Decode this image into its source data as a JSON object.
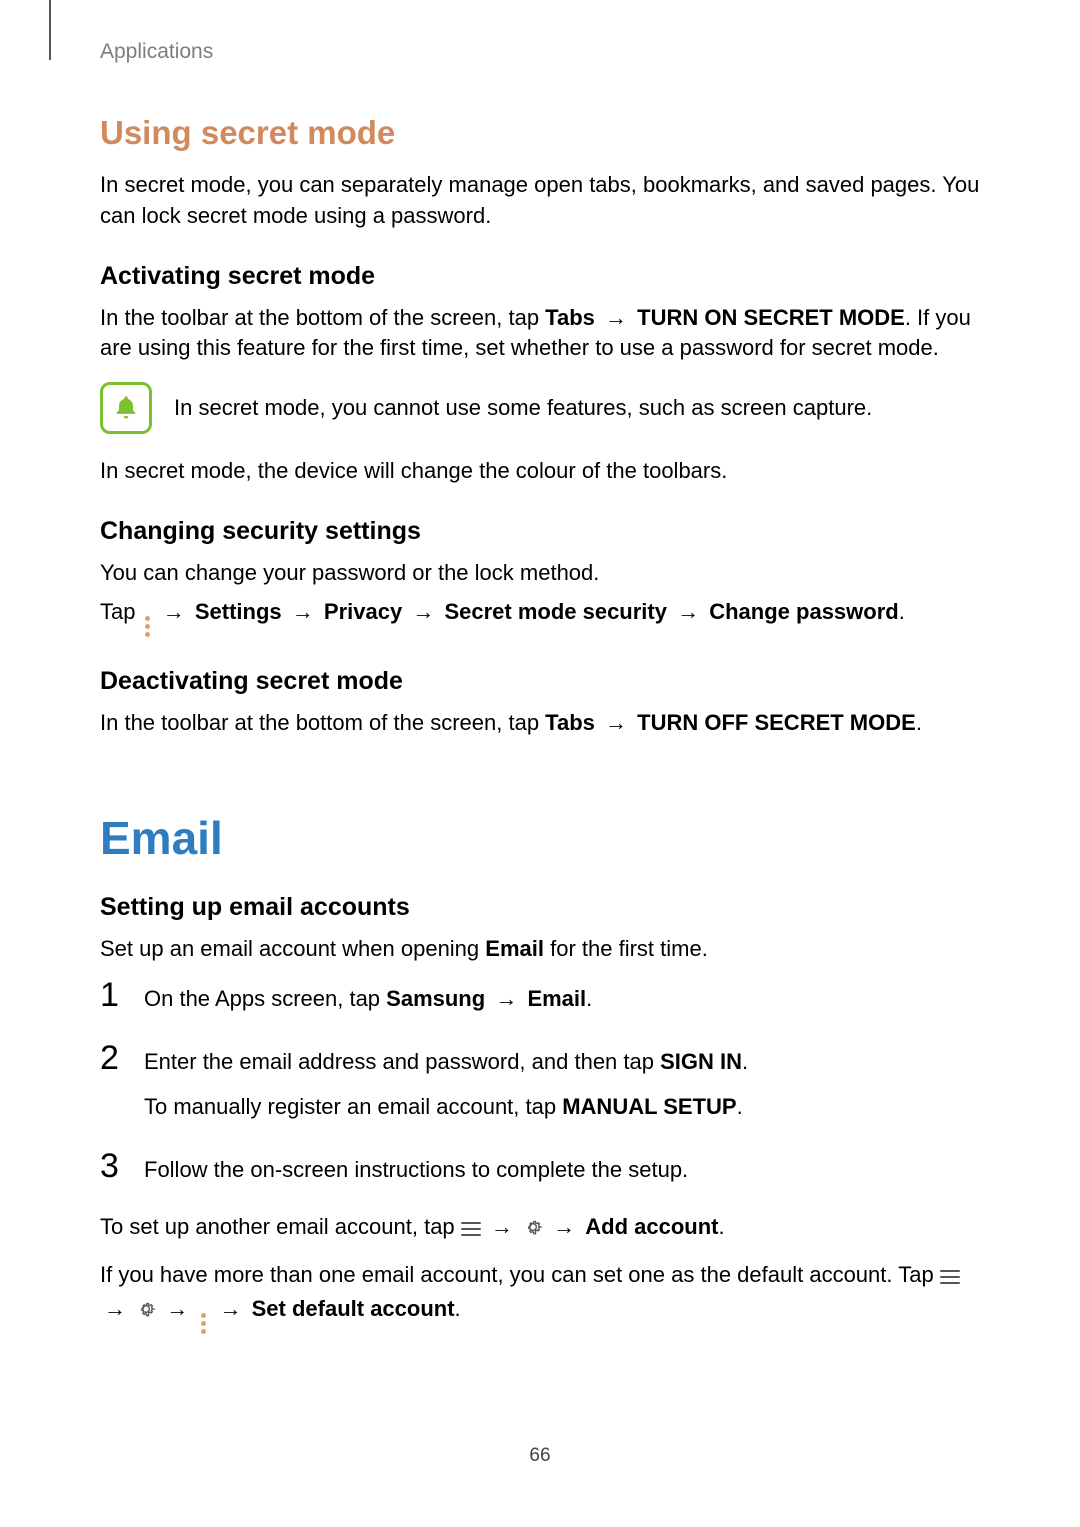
{
  "header": {
    "section": "Applications"
  },
  "secret_mode": {
    "title": "Using secret mode",
    "intro": "In secret mode, you can separately manage open tabs, bookmarks, and saved pages. You can lock secret mode using a password.",
    "activating": {
      "heading": "Activating secret mode",
      "p1_a": "In the toolbar at the bottom of the screen, tap ",
      "tabs": "Tabs",
      "arrow": "→",
      "turn_on": "TURN ON SECRET MODE",
      "p1_b": ". If you are using this feature for the first time, set whether to use a password for secret mode.",
      "note": "In secret mode, you cannot use some features, such as screen capture.",
      "after_note": "In secret mode, the device will change the colour of the toolbars."
    },
    "changing": {
      "heading": "Changing security settings",
      "p1": "You can change your password or the lock method.",
      "tap": "Tap ",
      "settings": "Settings",
      "privacy": "Privacy",
      "sms": "Secret mode security",
      "change": "Change password",
      "period": "."
    },
    "deactivating": {
      "heading": "Deactivating secret mode",
      "p1_a": "In the toolbar at the bottom of the screen, tap ",
      "tabs": "Tabs",
      "turn_off": "TURN OFF SECRET MODE",
      "period": "."
    }
  },
  "email": {
    "title": "Email",
    "setup_heading": "Setting up email accounts",
    "intro_a": "Set up an email account when opening ",
    "intro_b": "Email",
    "intro_c": " for the first time.",
    "steps": {
      "s1_a": "On the Apps screen, tap ",
      "s1_samsung": "Samsung",
      "s1_email": "Email",
      "s1_period": ".",
      "s2_a": "Enter the email address and password, and then tap ",
      "s2_signin": "SIGN IN",
      "s2_period": ".",
      "s2_sub_a": "To manually register an email account, tap ",
      "s2_manual": "MANUAL SETUP",
      "s2_sub_period": ".",
      "s3": "Follow the on-screen instructions to complete the setup."
    },
    "after_a": "To set up another email account, tap ",
    "add_account": "Add account",
    "period": ".",
    "default_a": "If you have more than one email account, you can set one as the default account. Tap ",
    "set_default": "Set default account",
    "arrow": "→"
  },
  "page_number": "66",
  "icons": {
    "bell": "bell-icon",
    "more_vert": "more-options-icon",
    "menu": "menu-icon",
    "gear": "settings-gear-icon"
  }
}
